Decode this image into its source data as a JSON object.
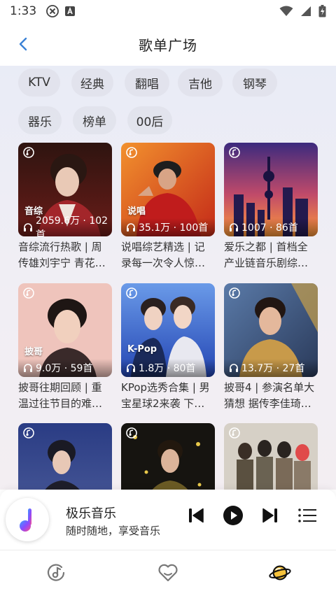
{
  "status_bar": {
    "time": "1:33"
  },
  "header": {
    "title": "歌单广场"
  },
  "tags": [
    "KTV",
    "经典",
    "翻唱",
    "吉他",
    "钢琴",
    "器乐",
    "榜单",
    "00后"
  ],
  "cards": [
    {
      "tag": "音综",
      "stats": "2059.6万 · 102首",
      "desc": "音综流行热歌 | 周传雄刘宇宁 青花…",
      "colors": [
        "#3a1a14",
        "#8a2a22"
      ]
    },
    {
      "tag": "说唱",
      "stats": "35.1万 · 100首",
      "desc": "说唱综艺精选 | 记录每一次令人惊…",
      "colors": [
        "#c9321c",
        "#f08a2c"
      ]
    },
    {
      "tag": "",
      "stats": "1007 · 86首",
      "desc": "爱乐之都 | 首档全产业链音乐剧综…",
      "colors": [
        "#3b2a7a",
        "#ff8a3a"
      ]
    },
    {
      "tag": "披哥",
      "stats": "9.0万 · 59首",
      "desc": "披哥往期回顾 | 重温过往节目的难…",
      "colors": [
        "#f1c7c0",
        "#c48c84"
      ]
    },
    {
      "tag": "K-Pop",
      "stats": "1.8万 · 80首",
      "desc": "KPop选秀合集 | 男宝星球2来袭 下…",
      "colors": [
        "#2c4fbf",
        "#6a98e8"
      ]
    },
    {
      "tag": "",
      "stats": "13.7万 · 27首",
      "desc": "披哥4 | 参演名单大猜想 据传李佳琦…",
      "colors": [
        "#3a5a88",
        "#c8a24a"
      ]
    },
    {
      "tag": "",
      "stats": "",
      "desc": "",
      "colors": [
        "#243a78",
        "#4a5a98"
      ]
    },
    {
      "tag": "",
      "stats": "",
      "desc": "",
      "colors": [
        "#1a1a14",
        "#6a5a1a"
      ]
    },
    {
      "tag": "",
      "stats": "",
      "desc": "",
      "colors": [
        "#d8d2c8",
        "#b8a898"
      ]
    }
  ],
  "player": {
    "title": "极乐音乐",
    "subtitle": "随时随地，享受音乐"
  },
  "nav": [
    "music-disc-icon",
    "heart-icon",
    "planet-icon"
  ]
}
